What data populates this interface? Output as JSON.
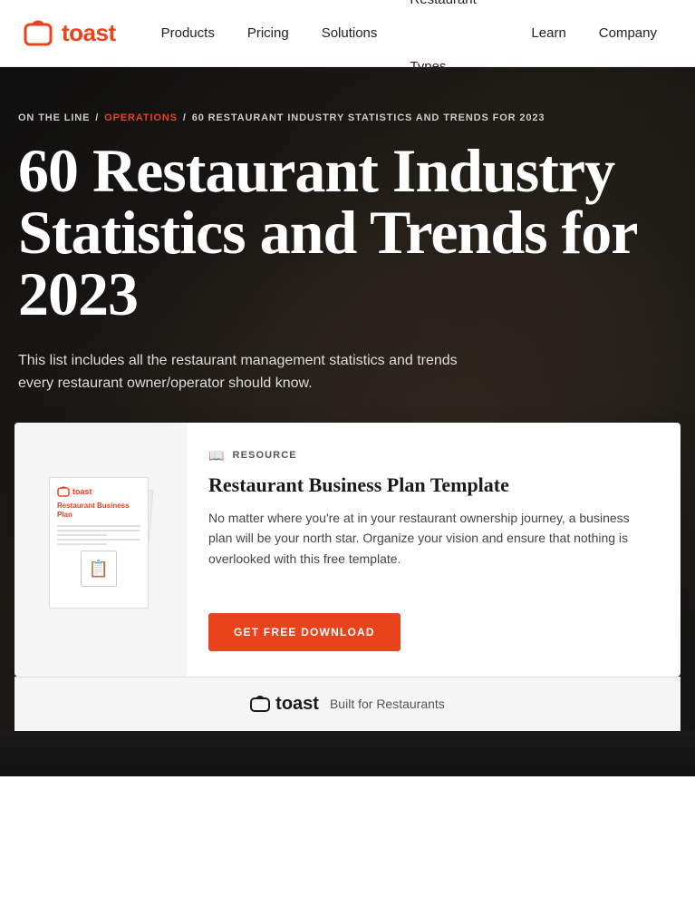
{
  "navbar": {
    "logo_text": "toast",
    "links": [
      {
        "label": "Products",
        "id": "products"
      },
      {
        "label": "Pricing",
        "id": "pricing"
      },
      {
        "label": "Solutions",
        "id": "solutions"
      },
      {
        "label": "Restaurant Types",
        "id": "restaurant-types"
      },
      {
        "label": "Learn",
        "id": "learn"
      },
      {
        "label": "Company",
        "id": "company"
      }
    ]
  },
  "breadcrumb": {
    "link1": "ON THE LINE",
    "sep1": " / ",
    "link2": "OPERATIONS",
    "sep2": " / ",
    "current": "60 RESTAURANT INDUSTRY STATISTICS AND TRENDS FOR 2023"
  },
  "hero": {
    "title": "60 Restaurant Industry Statistics and Trends for 2023",
    "subtitle": "This list includes all the restaurant management statistics and trends every restaurant owner/operator should know."
  },
  "resource_card": {
    "tag": "RESOURCE",
    "title": "Restaurant Business Plan Template",
    "description": "No matter where you're at in your restaurant ownership journey, a business plan will be your north star. Organize your vision and ensure that nothing is overlooked with this free template.",
    "cta_label": "GET FREE DOWNLOAD",
    "doc_title": "Restaurant Business Plan",
    "doc_logo": "toast"
  },
  "footer_bar": {
    "logo": "toast",
    "tagline": "Built for Restaurants"
  }
}
